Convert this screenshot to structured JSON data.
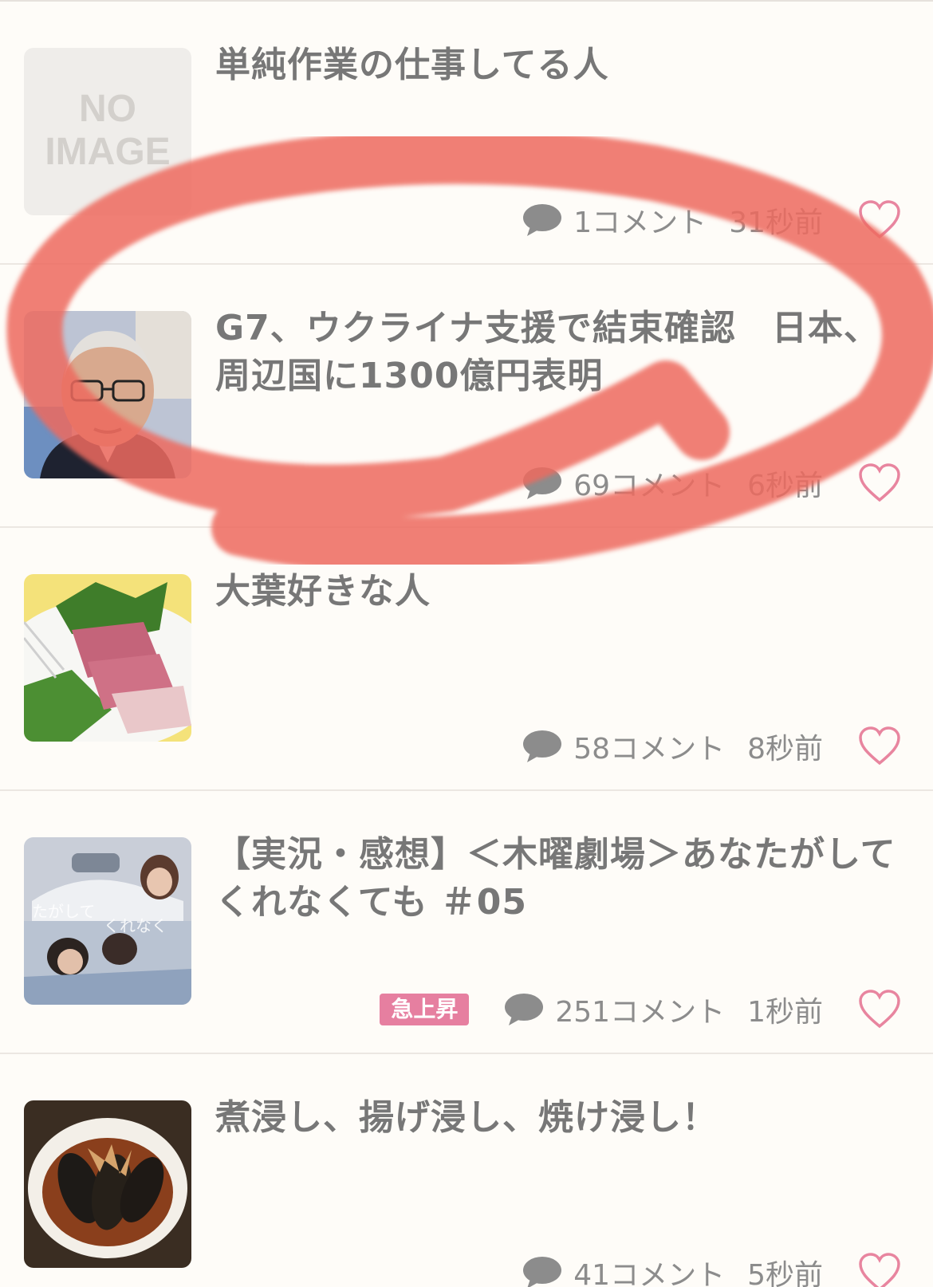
{
  "items": [
    {
      "title": "単純作業の仕事してる人",
      "thumb_text_line1": "NO",
      "thumb_text_line2": "IMAGE",
      "comments": "1コメント",
      "time": "31秒前",
      "badge": ""
    },
    {
      "title_line1": "G7、ウクライナ支援で結束確認　日本、",
      "title_line2": "周辺国に1300億円表明",
      "comments": "69コメント",
      "time": "6秒前",
      "badge": ""
    },
    {
      "title": "大葉好きな人",
      "comments": "58コメント",
      "time": "8秒前",
      "badge": ""
    },
    {
      "title_line1": "【実況・感想】＜木曜劇場＞あなたがして",
      "title_line2": "くれなくても ＃05",
      "comments": "251コメント",
      "time": "1秒前",
      "badge": "急上昇"
    },
    {
      "title": "煮浸し、揚げ浸し、焼け浸し！",
      "comments": "41コメント",
      "time": "5秒前",
      "badge": ""
    }
  ],
  "colors": {
    "background": "#fefcf8",
    "title": "#777777",
    "meta": "#8c8c8c",
    "heart": "#e8859f",
    "badge": "#e67fa0",
    "annotation": "#ee6a5f"
  }
}
